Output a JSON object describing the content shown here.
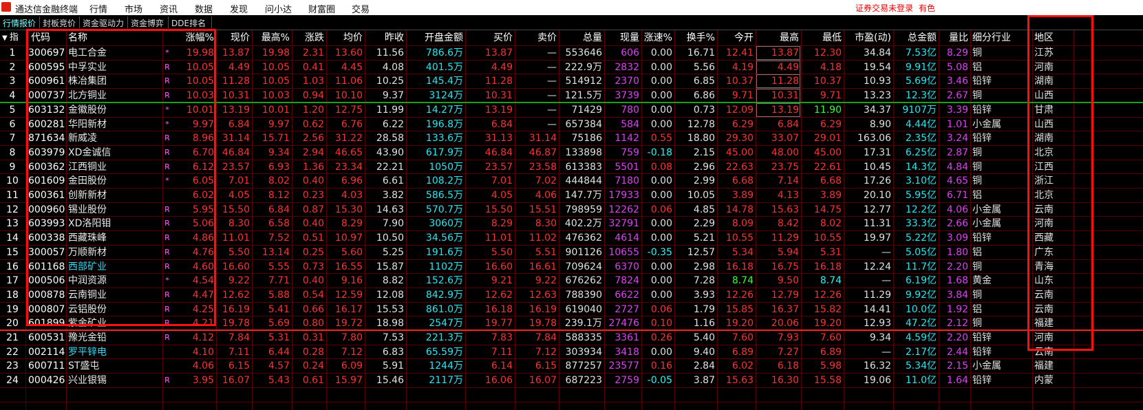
{
  "app": {
    "title": "通达信金融终端",
    "menus": [
      "行情",
      "市场",
      "资讯",
      "数据",
      "发现",
      "问小达",
      "财富圈",
      "交易"
    ],
    "login_status": "证券交易未登录",
    "color_mode": "有色"
  },
  "tabs": [
    "行情报价",
    "封板竞价",
    "资金驱动力",
    "资金博弈",
    "DDE排名"
  ],
  "table": {
    "corner_label": "指",
    "headers": [
      "代码",
      "名称",
      "涨幅%",
      "现价",
      "最高%",
      "涨跌",
      "均价",
      "昨收",
      "开盘金额",
      "买价",
      "卖价",
      "总量",
      "现量",
      "涨速%",
      "换手%",
      "今开",
      "最高",
      "最低",
      "市盈(动)",
      "总金额",
      "量比",
      "细分行业",
      "地区"
    ],
    "rows": [
      [
        "1",
        "300697",
        "电工合金",
        "*",
        "19.98",
        "13.87",
        "19.98",
        "2.31",
        "13.60",
        "11.56",
        "786.6万",
        "13.87",
        "—",
        "553646",
        "606",
        "0.00",
        "16.71",
        "12.41",
        "13.87",
        "12.30",
        "34.84",
        "7.53亿",
        "8.29",
        "铜",
        "江苏"
      ],
      [
        "2",
        "600595",
        "中孚实业",
        "R",
        "10.05",
        "4.49",
        "10.05",
        "0.41",
        "4.45",
        "4.08",
        "401.5万",
        "4.49",
        "—",
        "222.9万",
        "2832",
        "0.00",
        "5.56",
        "4.19",
        "4.49",
        "4.18",
        "19.54",
        "9.91亿",
        "5.08",
        "铝",
        "河南"
      ],
      [
        "3",
        "600961",
        "株冶集团",
        "R",
        "10.05",
        "11.28",
        "10.05",
        "1.03",
        "11.06",
        "10.25",
        "145.4万",
        "11.28",
        "—",
        "514912",
        "2370",
        "0.00",
        "6.85",
        "10.37",
        "11.28",
        "10.37",
        "10.93",
        "5.69亿",
        "3.46",
        "铅锌",
        "湖南"
      ],
      [
        "4",
        "000737",
        "北方铜业",
        "R",
        "10.03",
        "10.31",
        "10.03",
        "0.94",
        "10.10",
        "9.37",
        "3124万",
        "10.31",
        "—",
        "121.5万",
        "3739",
        "0.00",
        "6.86",
        "9.71",
        "10.31",
        "9.71",
        "13.23",
        "12.3亿",
        "2.67",
        "铜",
        "山西"
      ],
      [
        "5",
        "603132",
        "金徽股份",
        "*",
        "10.01",
        "13.19",
        "10.01",
        "1.20",
        "12.75",
        "11.99",
        "14.27万",
        "13.19",
        "—",
        "71429",
        "780",
        "0.00",
        "0.73",
        "12.09",
        "13.19",
        "11.90",
        "34.37",
        "9107万",
        "3.39",
        "铅锌",
        "甘肃"
      ],
      [
        "6",
        "600281",
        "华阳新材",
        "*",
        "9.97",
        "6.84",
        "9.97",
        "0.62",
        "6.76",
        "6.22",
        "196.8万",
        "6.84",
        "—",
        "657384",
        "584",
        "0.00",
        "12.78",
        "6.29",
        "6.84",
        "6.29",
        "8.90",
        "4.44亿",
        "1.01",
        "小金属",
        "山西"
      ],
      [
        "7",
        "871634",
        "新威凌",
        "R",
        "8.96",
        "31.14",
        "15.71",
        "2.56",
        "31.22",
        "28.58",
        "133.6万",
        "31.13",
        "31.14",
        "75186",
        "1142",
        "0.55",
        "18.80",
        "29.30",
        "33.07",
        "29.01",
        "163.06",
        "2.35亿",
        "3.24",
        "铅锌",
        "湖南"
      ],
      [
        "8",
        "603979",
        "XD金诚信",
        "R",
        "6.70",
        "46.84",
        "9.34",
        "2.94",
        "46.65",
        "43.90",
        "617.9万",
        "46.84",
        "46.87",
        "133898",
        "759",
        "-0.18",
        "2.15",
        "45.00",
        "48.00",
        "45.00",
        "17.31",
        "6.25亿",
        "2.87",
        "铜",
        "北京"
      ],
      [
        "9",
        "600362",
        "江西铜业",
        "R",
        "6.12",
        "23.57",
        "6.93",
        "1.36",
        "23.34",
        "22.21",
        "1050万",
        "23.57",
        "23.58",
        "613383",
        "5501",
        "0.08",
        "2.96",
        "22.63",
        "23.75",
        "22.61",
        "10.45",
        "14.3亿",
        "4.84",
        "铜",
        "江西"
      ],
      [
        "10",
        "601609",
        "金田股份",
        "*",
        "6.05",
        "7.01",
        "8.02",
        "0.40",
        "6.96",
        "6.61",
        "108.2万",
        "7.01",
        "7.02",
        "444844",
        "7180",
        "0.00",
        "2.99",
        "6.68",
        "7.14",
        "6.68",
        "17.26",
        "3.10亿",
        "4.65",
        "铜",
        "浙江"
      ],
      [
        "11",
        "600361",
        "创新新材",
        "",
        "6.02",
        "4.05",
        "8.12",
        "0.23",
        "4.03",
        "3.82",
        "586.5万",
        "4.05",
        "4.06",
        "147.7万",
        "17933",
        "0.00",
        "10.05",
        "3.89",
        "4.13",
        "3.89",
        "20.10",
        "5.95亿",
        "6.71",
        "铝",
        "北京"
      ],
      [
        "12",
        "000960",
        "锡业股份",
        "R",
        "5.95",
        "15.50",
        "6.84",
        "0.87",
        "15.30",
        "14.63",
        "570.7万",
        "15.50",
        "15.51",
        "798959",
        "12262",
        "0.06",
        "4.85",
        "14.78",
        "15.63",
        "14.75",
        "12.77",
        "12.2亿",
        "4.06",
        "小金属",
        "云南"
      ],
      [
        "13",
        "603993",
        "XD洛阳钼",
        "R",
        "5.06",
        "8.30",
        "6.58",
        "0.40",
        "8.29",
        "7.90",
        "3060万",
        "8.29",
        "8.30",
        "402.2万",
        "32791",
        "0.00",
        "2.29",
        "8.09",
        "8.42",
        "8.02",
        "11.31",
        "33.3亿",
        "2.66",
        "小金属",
        "河南"
      ],
      [
        "14",
        "600338",
        "西藏珠峰",
        "R",
        "4.86",
        "11.01",
        "7.52",
        "0.51",
        "10.97",
        "10.50",
        "34.56万",
        "11.01",
        "11.02",
        "476362",
        "4614",
        "0.00",
        "5.21",
        "10.55",
        "11.29",
        "10.55",
        "19.97",
        "5.22亿",
        "3.09",
        "铅锌",
        "西藏"
      ],
      [
        "15",
        "300057",
        "万顺新材",
        "R",
        "4.76",
        "5.50",
        "13.14",
        "0.25",
        "5.60",
        "5.25",
        "191.6万",
        "5.50",
        "5.51",
        "901126",
        "10655",
        "-0.35",
        "12.57",
        "5.34",
        "5.94",
        "5.31",
        "—",
        "5.05亿",
        "1.80",
        "铝",
        "广东"
      ],
      [
        "16",
        "601168",
        "西部矿业",
        "R",
        "4.60",
        "16.60",
        "5.55",
        "0.73",
        "16.55",
        "15.87",
        "1102万",
        "16.60",
        "16.61",
        "709624",
        "6370",
        "0.00",
        "2.98",
        "16.18",
        "16.75",
        "16.18",
        "12.24",
        "11.7亿",
        "2.20",
        "铜",
        "青海"
      ],
      [
        "17",
        "000506",
        "中润资源",
        "*",
        "4.54",
        "9.22",
        "7.71",
        "0.40",
        "9.16",
        "8.82",
        "152.6万",
        "9.21",
        "9.22",
        "676262",
        "7824",
        "0.00",
        "7.28",
        "8.74",
        "9.50",
        "8.74",
        "—",
        "6.19亿",
        "1.68",
        "黄金",
        "山东"
      ],
      [
        "18",
        "000878",
        "云南铜业",
        "R",
        "4.47",
        "12.62",
        "5.88",
        "0.54",
        "12.59",
        "12.08",
        "842.9万",
        "12.62",
        "12.63",
        "788390",
        "6622",
        "0.00",
        "3.93",
        "12.26",
        "12.79",
        "12.26",
        "11.29",
        "9.92亿",
        "3.84",
        "铜",
        "云南"
      ],
      [
        "19",
        "000807",
        "云铝股份",
        "R",
        "4.25",
        "16.19",
        "5.41",
        "0.66",
        "16.17",
        "15.53",
        "861.0万",
        "16.18",
        "16.19",
        "619040",
        "2727",
        "0.06",
        "1.79",
        "15.85",
        "16.37",
        "15.82",
        "14.41",
        "10.0亿",
        "1.92",
        "铝",
        "云南"
      ],
      [
        "20",
        "601899",
        "紫金矿业",
        "R",
        "4.21",
        "19.78",
        "5.69",
        "0.80",
        "19.72",
        "18.98",
        "2547万",
        "19.77",
        "19.78",
        "239.1万",
        "27476",
        "0.10",
        "1.16",
        "19.20",
        "20.06",
        "19.20",
        "12.93",
        "47.2亿",
        "2.12",
        "铜",
        "福建"
      ],
      [
        "21",
        "600531",
        "豫光金铅",
        "R",
        "4.12",
        "7.84",
        "5.31",
        "0.31",
        "7.80",
        "7.53",
        "221.3万",
        "7.83",
        "7.84",
        "588335",
        "3361",
        "0.26",
        "5.40",
        "7.60",
        "7.93",
        "7.60",
        "9.34",
        "4.59亿",
        "2.20",
        "铅锌",
        "河南"
      ],
      [
        "22",
        "002114",
        "罗平锌电",
        "",
        "4.10",
        "7.11",
        "6.44",
        "0.28",
        "7.12",
        "6.83",
        "65.59万",
        "7.11",
        "7.12",
        "303934",
        "3418",
        "0.00",
        "9.40",
        "6.89",
        "7.27",
        "6.89",
        "—",
        "2.17亿",
        "2.44",
        "铅锌",
        "云南"
      ],
      [
        "23",
        "600711",
        "ST盛屯",
        "",
        "4.06",
        "6.15",
        "4.57",
        "0.24",
        "6.09",
        "5.91",
        "1244万",
        "6.14",
        "6.15",
        "877257",
        "23577",
        "0.16",
        "2.84",
        "6.02",
        "6.18",
        "5.98",
        "16.32",
        "5.34亿",
        "2.15",
        "小金属",
        "福建"
      ],
      [
        "24",
        "000426",
        "兴业银锡",
        "R",
        "3.95",
        "16.07",
        "5.43",
        "0.61",
        "15.97",
        "15.46",
        "2117万",
        "16.06",
        "16.07",
        "687223",
        "2759",
        "-0.05",
        "3.87",
        "15.63",
        "16.30",
        "15.58",
        "19.06",
        "11.0亿",
        "1.64",
        "铅锌",
        "内蒙"
      ]
    ]
  },
  "colors": {
    "up": "#ff3030",
    "down": "#30ff30",
    "flat": "#e0e0e0",
    "cyan": "#29e6f0",
    "magenta": "#e040f0",
    "yellow": "#f0f000",
    "name_default": "#e8e8e8",
    "name_cyan": "#31d9f2"
  }
}
